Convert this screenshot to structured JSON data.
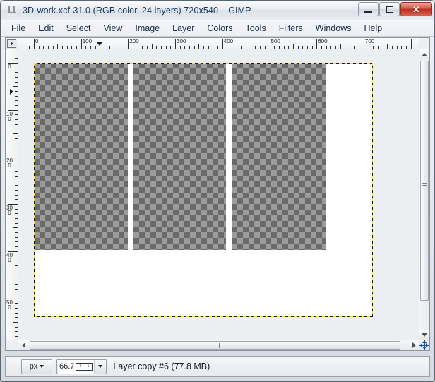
{
  "window": {
    "title": "3D-work.xcf-31.0 (RGB color, 24 layers) 720x540 – GIMP",
    "icon": "gimp-wilber-icon",
    "minimize_label": "Minimize",
    "maximize_label": "Maximize",
    "close_label": "Close",
    "close_glyph": "✕"
  },
  "menubar": {
    "items": [
      {
        "name": "file",
        "mnemonic": "F",
        "rest": "ile"
      },
      {
        "name": "edit",
        "mnemonic": "E",
        "rest": "dit"
      },
      {
        "name": "select",
        "mnemonic": "S",
        "rest": "elect"
      },
      {
        "name": "view",
        "mnemonic": "V",
        "rest": "iew"
      },
      {
        "name": "image",
        "mnemonic": "I",
        "rest": "mage"
      },
      {
        "name": "layer",
        "mnemonic": "L",
        "rest": "ayer"
      },
      {
        "name": "colors",
        "mnemonic": "C",
        "rest": "olors"
      },
      {
        "name": "tools",
        "mnemonic": "T",
        "rest": "ools"
      },
      {
        "name": "filters",
        "mnemonic": "r",
        "rest": "",
        "pre": "Filte",
        "post": "s"
      },
      {
        "name": "windows",
        "mnemonic": "W",
        "rest": "indows"
      },
      {
        "name": "help",
        "mnemonic": "H",
        "rest": "elp"
      }
    ]
  },
  "rulers": {
    "unit": "px",
    "horizontal_labels": [
      "0",
      "100",
      "200",
      "300",
      "400",
      "500",
      "600",
      "700"
    ],
    "vertical_labels": [
      "0",
      "100",
      "200",
      "300",
      "400",
      "500"
    ],
    "pointer_x": "140",
    "pointer_y": "62"
  },
  "canvas": {
    "image_width": "720",
    "image_height": "540",
    "boundary_color_a": "#ffe600",
    "boundary_color_b": "#111111",
    "background_color": "#ffffff",
    "checker_light": "#9b9b9b",
    "checker_dark": "#6a6a6a",
    "layer_panels": [
      {
        "name": "layer-panel-left"
      },
      {
        "name": "layer-panel-middle"
      },
      {
        "name": "layer-panel-right"
      }
    ]
  },
  "statusbar": {
    "unit_value": "px",
    "zoom_value": "66.7",
    "zoom_mini_left": "1",
    "zoom_mini_right": "1",
    "status_message": "Layer copy #6 (77.8 MB)"
  },
  "scrollbars": {
    "navigation_icon": "navigate-icon",
    "zoom_image_icon": "zoom-image-icon"
  }
}
